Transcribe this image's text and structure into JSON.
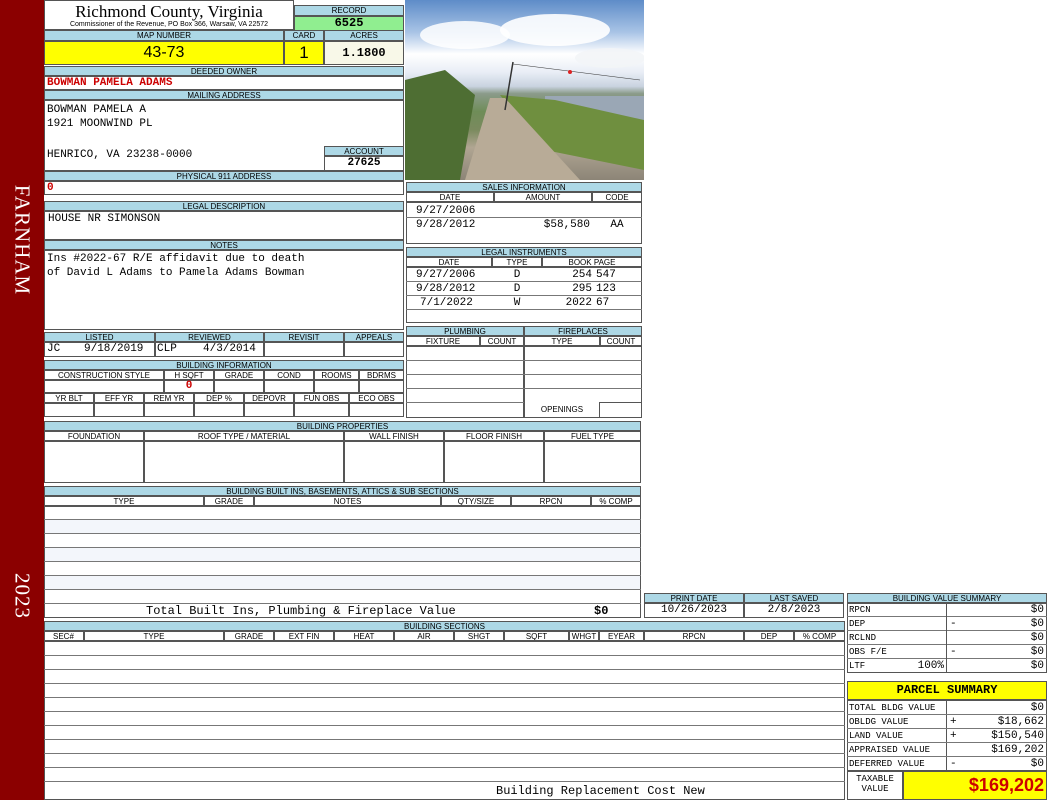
{
  "sidebar": {
    "district": "FARNHAM",
    "year": "2023"
  },
  "header": {
    "county": "Richmond County, Virginia",
    "address": "Commissioner of the Revenue, PO Box 366, Warsaw, VA 22572",
    "record_label": "RECORD",
    "record": "6525",
    "map_label": "MAP NUMBER",
    "map": "43-73",
    "card_label": "CARD",
    "card": "1",
    "acres_label": "ACRES",
    "acres": "1.1800"
  },
  "owner": {
    "deeded_label": "DEEDED OWNER",
    "deeded": "BOWMAN PAMELA ADAMS",
    "mailing_label": "MAILING ADDRESS",
    "mail_line1": "BOWMAN PAMELA A",
    "mail_line2": "1921 MOONWIND PL",
    "mail_line3": "HENRICO, VA 23238-0000",
    "account_label": "ACCOUNT",
    "account": "27625",
    "physical_label": "PHYSICAL 911 ADDRESS",
    "physical": "0"
  },
  "legal": {
    "label": "LEGAL DESCRIPTION",
    "text": "HOUSE NR SIMONSON"
  },
  "notes": {
    "label": "NOTES",
    "line1": "Ins #2022-67 R/E affidavit due to death",
    "line2": "of David L Adams to Pamela Adams Bowman"
  },
  "sales": {
    "title": "SALES INFORMATION",
    "headers": [
      "DATE",
      "AMOUNT",
      "CODE"
    ],
    "rows": [
      {
        "date": "9/27/2006",
        "amount": "",
        "code": ""
      },
      {
        "date": "9/28/2012",
        "amount": "$58,580",
        "code": "AA"
      }
    ]
  },
  "instruments": {
    "title": "LEGAL INSTRUMENTS",
    "headers": [
      "DATE",
      "TYPE",
      "BOOK PAGE"
    ],
    "rows": [
      {
        "date": "9/27/2006",
        "type": "D",
        "book": "254",
        "page": "547"
      },
      {
        "date": "9/28/2012",
        "type": "D",
        "book": "295",
        "page": "123"
      },
      {
        "date": "7/1/2022",
        "type": "W",
        "book": "2022",
        "page": "67"
      }
    ]
  },
  "listing": {
    "listed_label": "LISTED",
    "listed_by": "JC",
    "listed_date": "9/18/2019",
    "reviewed_label": "REVIEWED",
    "reviewed_by": "CLP",
    "reviewed_date": "4/3/2014",
    "revisit_label": "REVISIT",
    "appeals_label": "APPEALS"
  },
  "building_info": {
    "title": "BUILDING INFORMATION",
    "row1": [
      "CONSTRUCTION STYLE",
      "H SQFT",
      "GRADE",
      "COND",
      "ROOMS",
      "BDRMS"
    ],
    "hsqft": "0",
    "row2": [
      "YR BLT",
      "EFF YR",
      "REM YR",
      "DEP %",
      "DEPOVR",
      "FUN OBS",
      "ECO OBS"
    ]
  },
  "plumbing": {
    "title": "PLUMBING",
    "headers": [
      "FIXTURE",
      "COUNT"
    ]
  },
  "fireplaces": {
    "title": "FIREPLACES",
    "headers": [
      "TYPE",
      "COUNT"
    ],
    "openings": "OPENINGS"
  },
  "properties": {
    "title": "BUILDING PROPERTIES",
    "headers": [
      "FOUNDATION",
      "ROOF TYPE / MATERIAL",
      "WALL FINISH",
      "FLOOR FINISH",
      "FUEL TYPE"
    ]
  },
  "builtins": {
    "title": "BUILDING BUILT INS, BASEMENTS, ATTICS & SUB SECTIONS",
    "headers": [
      "TYPE",
      "GRADE",
      "NOTES",
      "QTY/SIZE",
      "RPCN",
      "% COMP"
    ],
    "total_label": "Total Built Ins, Plumbing & Fireplace Value",
    "total": "$0"
  },
  "dates": {
    "print_label": "PRINT DATE",
    "print": "10/26/2023",
    "saved_label": "LAST SAVED",
    "saved": "2/8/2023"
  },
  "sections": {
    "title": "BUILDING SECTIONS",
    "headers": [
      "SEC#",
      "TYPE",
      "GRADE",
      "EXT FIN",
      "HEAT",
      "AIR",
      "SHGT",
      "SQFT",
      "WHGT",
      "EYEAR",
      "RPCN",
      "DEP",
      "% COMP"
    ],
    "footer": "Building Replacement Cost New"
  },
  "bvs": {
    "title": "BUILDING VALUE SUMMARY",
    "rows": [
      {
        "label": "RPCN",
        "pct": "",
        "sign": "",
        "value": "$0"
      },
      {
        "label": "DEP",
        "pct": "",
        "sign": "-",
        "value": "$0"
      },
      {
        "label": "RCLND",
        "pct": "",
        "sign": "",
        "value": "$0"
      },
      {
        "label": "OBS F/E",
        "pct": "",
        "sign": "-",
        "value": "$0"
      },
      {
        "label": "LTF",
        "pct": "100%",
        "sign": "",
        "value": "$0"
      }
    ]
  },
  "parcel": {
    "title": "PARCEL SUMMARY",
    "rows": [
      {
        "label": "TOTAL BLDG VALUE",
        "sign": "",
        "value": "$0"
      },
      {
        "label": "OBLDG VALUE",
        "sign": "+",
        "value": "$18,662"
      },
      {
        "label": "LAND VALUE",
        "sign": "+",
        "value": "$150,540"
      },
      {
        "label": "APPRAISED VALUE",
        "sign": "",
        "value": "$169,202"
      },
      {
        "label": "DEFERRED VALUE",
        "sign": "-",
        "value": "$0"
      }
    ],
    "taxable_label1": "TAXABLE",
    "taxable_label2": "VALUE",
    "taxable": "$169,202"
  },
  "colors": {
    "sidebar": "#8b0000",
    "header_blue": "#add8e6",
    "yellow": "#ffff00",
    "record_green": "#90ee90",
    "owner_red": "#cc0000"
  }
}
